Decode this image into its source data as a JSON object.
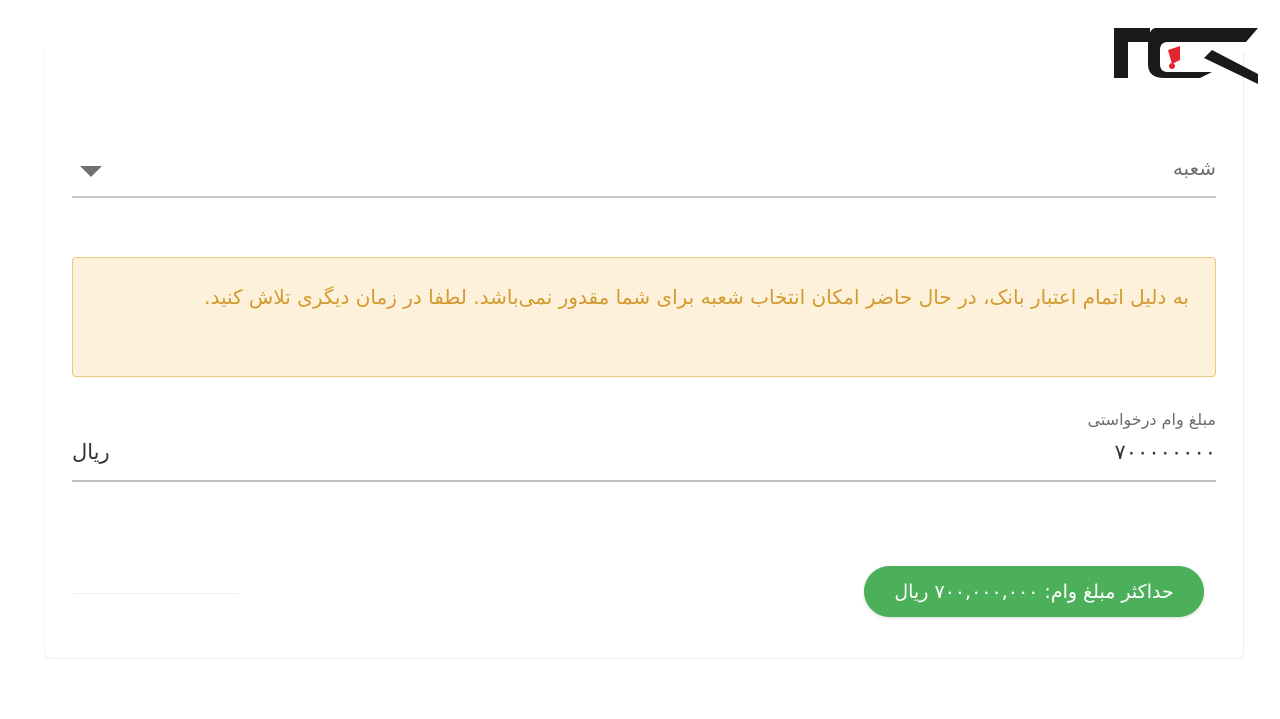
{
  "logo": {
    "icon": "rokna-logo",
    "colors": {
      "mark": "#1a1a1a",
      "accent": "#e3262e"
    }
  },
  "branch_select": {
    "label": "شعبه",
    "icon": "caret-down"
  },
  "alert": {
    "text": "به دلیل اتمام اعتبار بانک، در حال حاضر امکان انتخاب شعبه برای شما مقدور نمی‌باشد. لطفا در زمان دیگری تلاش کنید.",
    "colors": {
      "background": "#fdf1dc",
      "border": "#ecc97a",
      "text": "#d39a2e"
    }
  },
  "loan_amount": {
    "label": "مبلغ وام درخواستی",
    "value": "۷۰۰۰۰۰۰۰۰",
    "unit": "ریال"
  },
  "max_loan_badge": {
    "text": "حداکثر مبلغ وام: ۷۰۰,۰۰۰,۰۰۰ ریال",
    "color": "#4cb05a"
  }
}
